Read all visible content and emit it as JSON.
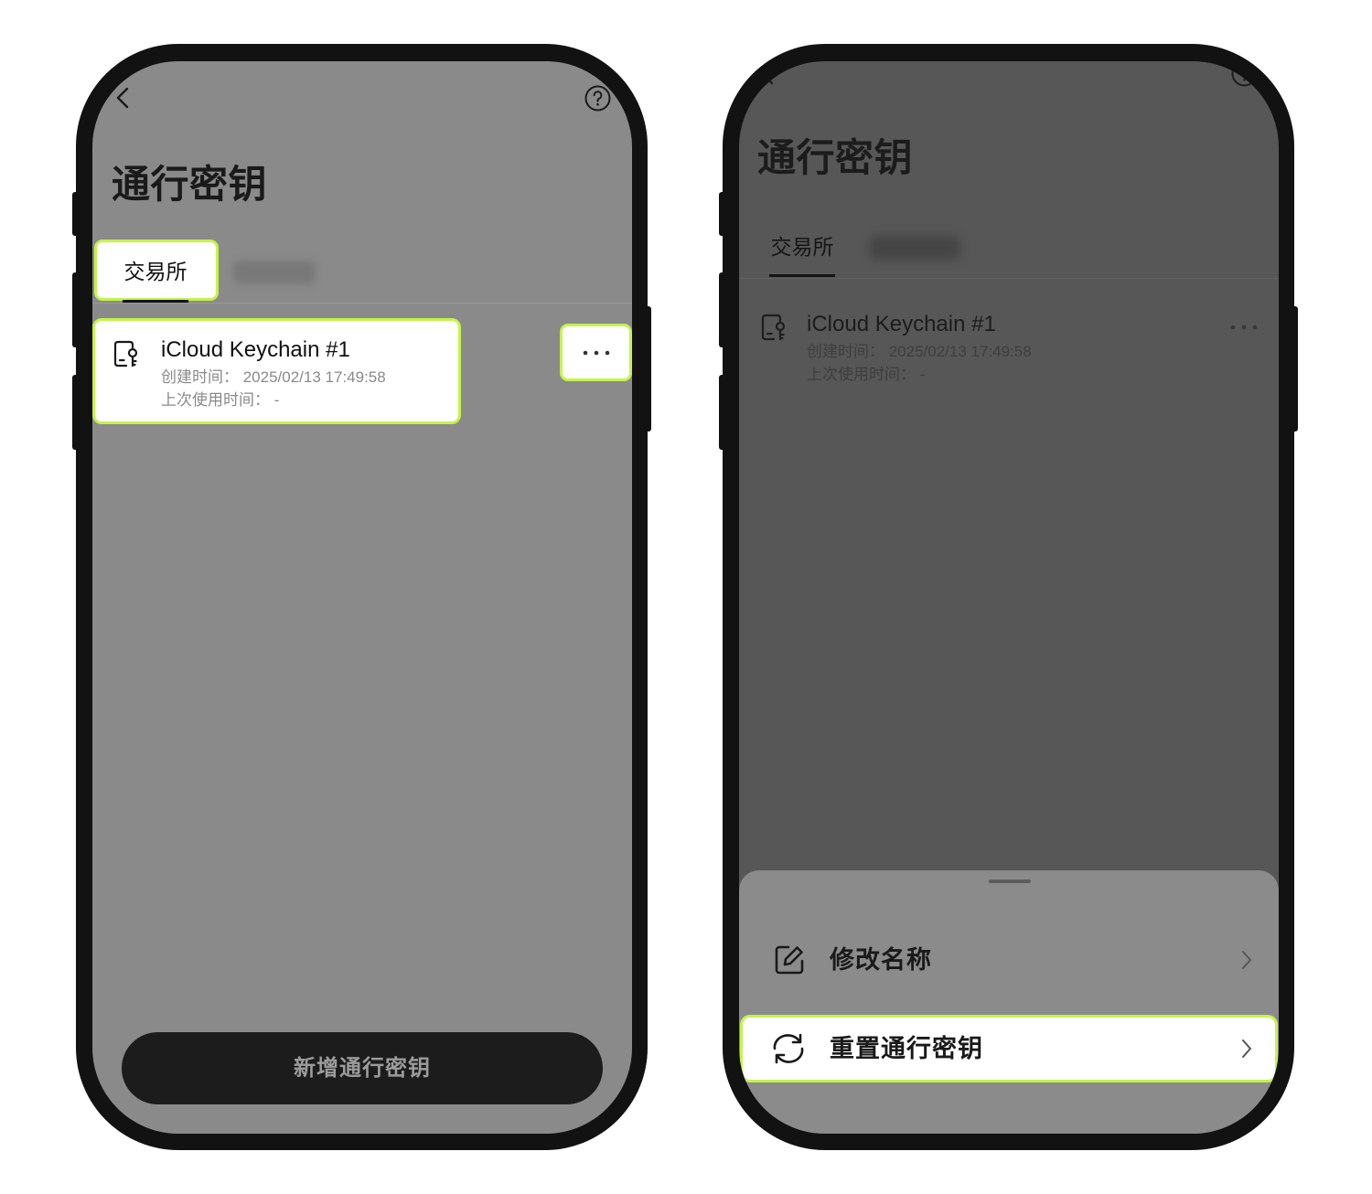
{
  "left": {
    "title": "通行密钥",
    "tabs": [
      {
        "label": "交易所",
        "active": true
      }
    ],
    "passkey": {
      "name": "iCloud Keychain #1",
      "created": "创建时间： 2025/02/13 17:49:58",
      "last_used": "上次使用时间： -"
    },
    "add_button_label": "新增通行密钥"
  },
  "right": {
    "title": "通行密钥",
    "tabs": [
      {
        "label": "交易所",
        "active": true
      }
    ],
    "passkey": {
      "name": "iCloud Keychain #1",
      "created": "创建时间： 2025/02/13 17:49:58",
      "last_used": "上次使用时间： -"
    },
    "sheet": {
      "items": [
        {
          "label": "修改名称",
          "icon": "edit-icon"
        },
        {
          "label": "重置通行密钥",
          "icon": "refresh-icon"
        }
      ]
    }
  },
  "icons": {
    "back": "chevron-left-icon",
    "help": "help-icon",
    "passkey": "passkey-document-icon",
    "more": "more-dots-icon",
    "row_arrow": "chevron-right-icon"
  },
  "colors": {
    "highlight": "#c5f34b",
    "left_screen": "#8a8a8a",
    "right_screen": "#575757",
    "sheet": "#8b8b8b",
    "button": "#1c1c1c"
  }
}
